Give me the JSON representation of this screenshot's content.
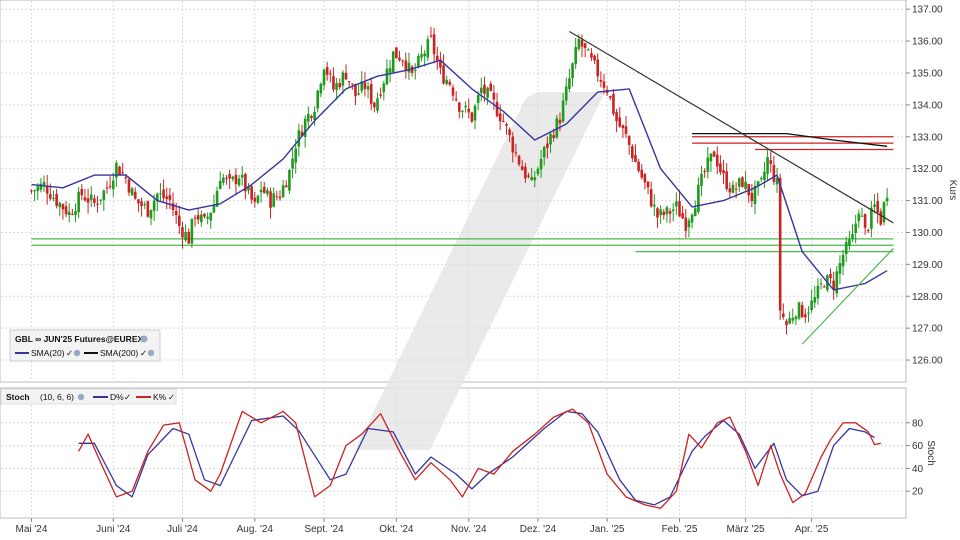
{
  "chart_data": [
    {
      "type": "candlestick",
      "instrument": "GBL ∞ JUN'25 Futures@EUREX",
      "ylabel": "Kurs",
      "ylim": [
        125.5,
        137.1
      ],
      "yticks": [
        126.0,
        127.0,
        128.0,
        129.0,
        130.0,
        131.0,
        132.0,
        133.0,
        134.0,
        135.0,
        136.0,
        137.0
      ],
      "ytick_labels": [
        "126.00",
        "127.00",
        "128.00",
        "129.00",
        "130.00",
        "131.00",
        "132.00",
        "133.00",
        "134.00",
        "135.00",
        "136.00",
        "137.00"
      ],
      "legend": [
        {
          "label": "SMA(20)",
          "color": "#3535a0"
        },
        {
          "label": "SMA(200)",
          "color": "#111111"
        }
      ],
      "colors": {
        "up": "#1e9b1e",
        "down": "#cc2222",
        "sma20": "#3535a0",
        "sma200": "#111111",
        "support": "#49b949",
        "resistance": "#cc2222",
        "trendline": "#333333"
      },
      "close_path": [
        [
          0,
          131.3
        ],
        [
          4,
          131.5
        ],
        [
          8,
          131.0
        ],
        [
          12,
          130.6
        ],
        [
          16,
          131.2
        ],
        [
          20,
          130.9
        ],
        [
          24,
          131.4
        ],
        [
          27,
          132.1
        ],
        [
          30,
          131.7
        ],
        [
          33,
          131.0
        ],
        [
          37,
          130.7
        ],
        [
          40,
          131.2
        ],
        [
          44,
          131.0
        ],
        [
          47,
          130.2
        ],
        [
          50,
          129.8
        ],
        [
          52,
          130.6
        ],
        [
          55,
          130.3
        ],
        [
          58,
          130.9
        ],
        [
          60,
          131.8
        ],
        [
          63,
          131.5
        ],
        [
          66,
          131.8
        ],
        [
          69,
          131.2
        ],
        [
          71,
          130.8
        ],
        [
          73,
          131.4
        ],
        [
          76,
          131.0
        ],
        [
          79,
          131.2
        ],
        [
          82,
          131.9
        ],
        [
          84,
          132.8
        ],
        [
          87,
          133.5
        ],
        [
          90,
          134.0
        ],
        [
          93,
          135.3
        ],
        [
          96,
          134.5
        ],
        [
          100,
          135.0
        ],
        [
          103,
          134.3
        ],
        [
          106,
          134.6
        ],
        [
          109,
          134.0
        ],
        [
          112,
          134.8
        ],
        [
          115,
          135.6
        ],
        [
          118,
          135.5
        ],
        [
          121,
          134.9
        ],
        [
          124,
          135.5
        ],
        [
          127,
          136.0
        ],
        [
          130,
          135.0
        ],
        [
          133,
          134.7
        ],
        [
          136,
          134.0
        ],
        [
          140,
          133.6
        ],
        [
          143,
          134.5
        ],
        [
          146,
          134.2
        ],
        [
          150,
          133.5
        ],
        [
          153,
          132.7
        ],
        [
          156,
          132.0
        ],
        [
          159,
          131.5
        ],
        [
          162,
          132.3
        ],
        [
          165,
          133.0
        ],
        [
          168,
          133.6
        ],
        [
          171,
          134.8
        ],
        [
          174,
          136.0
        ],
        [
          177,
          135.5
        ],
        [
          180,
          135.0
        ],
        [
          183,
          134.5
        ],
        [
          186,
          133.5
        ],
        [
          189,
          133.0
        ],
        [
          192,
          132.2
        ],
        [
          195,
          131.5
        ],
        [
          199,
          130.5
        ],
        [
          202,
          130.6
        ],
        [
          205,
          130.8
        ],
        [
          208,
          130.3
        ],
        [
          211,
          131.0
        ],
        [
          214,
          131.9
        ],
        [
          217,
          132.5
        ],
        [
          220,
          131.7
        ],
        [
          223,
          131.3
        ],
        [
          226,
          131.6
        ],
        [
          229,
          131.1
        ],
        [
          232,
          131.5
        ],
        [
          234,
          132.3
        ],
        [
          237,
          131.5
        ],
        [
          238,
          127.6
        ],
        [
          240,
          127.1
        ],
        [
          243,
          127.6
        ],
        [
          246,
          127.5
        ],
        [
          249,
          127.9
        ],
        [
          252,
          128.5
        ],
        [
          255,
          128.4
        ],
        [
          258,
          129.3
        ],
        [
          261,
          129.8
        ],
        [
          263,
          130.8
        ],
        [
          265,
          130.0
        ],
        [
          268,
          130.8
        ],
        [
          270,
          130.4
        ],
        [
          272,
          131.3
        ]
      ],
      "sma20_path": [
        [
          0,
          131.5
        ],
        [
          10,
          131.4
        ],
        [
          20,
          131.8
        ],
        [
          30,
          131.8
        ],
        [
          40,
          131.0
        ],
        [
          50,
          130.7
        ],
        [
          60,
          130.9
        ],
        [
          70,
          131.5
        ],
        [
          80,
          132.3
        ],
        [
          90,
          133.5
        ],
        [
          100,
          134.5
        ],
        [
          110,
          134.9
        ],
        [
          120,
          135.1
        ],
        [
          130,
          135.4
        ],
        [
          140,
          134.5
        ],
        [
          150,
          133.8
        ],
        [
          160,
          132.9
        ],
        [
          170,
          133.4
        ],
        [
          180,
          134.4
        ],
        [
          190,
          134.5
        ],
        [
          200,
          132.0
        ],
        [
          210,
          130.8
        ],
        [
          220,
          131.0
        ],
        [
          230,
          131.4
        ],
        [
          237,
          131.8
        ],
        [
          245,
          129.4
        ],
        [
          255,
          128.2
        ],
        [
          265,
          128.4
        ],
        [
          272,
          128.8
        ]
      ],
      "sma200_path": [
        [
          210,
          133.1
        ],
        [
          225,
          133.1
        ],
        [
          240,
          133.1
        ],
        [
          255,
          132.9
        ],
        [
          272,
          132.7
        ]
      ],
      "horizontal_lines": [
        {
          "value": 129.8,
          "from": 0,
          "to": 274,
          "color": "#49b949"
        },
        {
          "value": 129.6,
          "from": 0,
          "to": 274,
          "color": "#49b949"
        },
        {
          "value": 129.4,
          "from": 192,
          "to": 274,
          "color": "#49b949"
        },
        {
          "value": 133.0,
          "from": 210,
          "to": 274,
          "color": "#cc2222"
        },
        {
          "value": 132.8,
          "from": 210,
          "to": 274,
          "color": "#cc2222"
        },
        {
          "value": 132.6,
          "from": 230,
          "to": 274,
          "color": "#cc2222"
        }
      ],
      "trendlines": [
        {
          "from": [
            171,
            136.3
          ],
          "to": [
            274,
            130.3
          ],
          "color": "#333333"
        },
        {
          "from": [
            245,
            126.5
          ],
          "to": [
            274,
            129.5
          ],
          "color": "#49b949"
        }
      ]
    },
    {
      "type": "line",
      "title": "Stoch",
      "params": "(10, 6, 6)",
      "ylabel": "Stoch",
      "ylim": [
        0,
        100
      ],
      "yticks": [
        20,
        40,
        60,
        80
      ],
      "ytick_labels": [
        "20",
        "40",
        "60",
        "80"
      ],
      "series": [
        {
          "name": "D%",
          "color": "#3535a0",
          "points": [
            [
              15,
              62
            ],
            [
              20,
              62
            ],
            [
              27,
              25
            ],
            [
              32,
              15
            ],
            [
              37,
              52
            ],
            [
              45,
              75
            ],
            [
              50,
              70
            ],
            [
              55,
              30
            ],
            [
              60,
              25
            ],
            [
              70,
              82
            ],
            [
              80,
              86
            ],
            [
              85,
              73
            ],
            [
              95,
              30
            ],
            [
              100,
              35
            ],
            [
              107,
              75
            ],
            [
              115,
              72
            ],
            [
              122,
              35
            ],
            [
              127,
              50
            ],
            [
              135,
              35
            ],
            [
              140,
              22
            ],
            [
              145,
              35
            ],
            [
              153,
              50
            ],
            [
              163,
              75
            ],
            [
              170,
              90
            ],
            [
              175,
              88
            ],
            [
              180,
              72
            ],
            [
              187,
              30
            ],
            [
              192,
              12
            ],
            [
              198,
              8
            ],
            [
              203,
              15
            ],
            [
              210,
              55
            ],
            [
              214,
              68
            ],
            [
              220,
              82
            ],
            [
              225,
              70
            ],
            [
              230,
              40
            ],
            [
              236,
              62
            ],
            [
              240,
              30
            ],
            [
              245,
              16
            ],
            [
              250,
              20
            ],
            [
              255,
              60
            ],
            [
              260,
              75
            ],
            [
              265,
              72
            ],
            [
              268,
              67
            ]
          ]
        },
        {
          "name": "K%",
          "color": "#cc2222",
          "points": [
            [
              15,
              55
            ],
            [
              18,
              70
            ],
            [
              22,
              45
            ],
            [
              27,
              15
            ],
            [
              32,
              20
            ],
            [
              37,
              55
            ],
            [
              42,
              78
            ],
            [
              47,
              80
            ],
            [
              52,
              30
            ],
            [
              57,
              20
            ],
            [
              60,
              35
            ],
            [
              67,
              90
            ],
            [
              73,
              80
            ],
            [
              80,
              90
            ],
            [
              84,
              80
            ],
            [
              90,
              15
            ],
            [
              95,
              25
            ],
            [
              100,
              60
            ],
            [
              105,
              70
            ],
            [
              111,
              88
            ],
            [
              117,
              55
            ],
            [
              122,
              30
            ],
            [
              127,
              45
            ],
            [
              133,
              30
            ],
            [
              137,
              15
            ],
            [
              142,
              40
            ],
            [
              147,
              35
            ],
            [
              153,
              55
            ],
            [
              160,
              70
            ],
            [
              166,
              85
            ],
            [
              172,
              92
            ],
            [
              177,
              80
            ],
            [
              183,
              35
            ],
            [
              189,
              15
            ],
            [
              195,
              8
            ],
            [
              200,
              5
            ],
            [
              205,
              20
            ],
            [
              209,
              70
            ],
            [
              213,
              58
            ],
            [
              218,
              80
            ],
            [
              222,
              85
            ],
            [
              227,
              55
            ],
            [
              231,
              25
            ],
            [
              235,
              60
            ],
            [
              238,
              35
            ],
            [
              242,
              10
            ],
            [
              246,
              18
            ],
            [
              251,
              50
            ],
            [
              254,
              65
            ],
            [
              258,
              80
            ],
            [
              262,
              80
            ],
            [
              266,
              72
            ],
            [
              268,
              61
            ],
            [
              270,
              62
            ]
          ]
        }
      ]
    }
  ],
  "x_axis": {
    "tick_labels": [
      "Mai '24",
      "Juni '24",
      "Juli '24",
      "Aug. '24",
      "Sept. '24",
      "Okt. '24",
      "Nov. '24",
      "Dez. '24",
      "Jan. '25",
      "Feb. '25",
      "März '25",
      "Apr. '25"
    ],
    "tick_days": [
      0,
      26,
      48,
      71,
      93,
      116,
      139,
      161,
      183,
      206,
      227,
      248
    ],
    "day_range": [
      -10,
      278
    ]
  },
  "legend_main_title": "GBL ∞ JUN'25 Futures@EUREX",
  "legend_sma20": "SMA(20)",
  "legend_sma200": "SMA(200)",
  "stoch_title": "Stoch",
  "stoch_params": "(10, 6, 6)",
  "stoch_d_label": "D%",
  "stoch_k_label": "K%",
  "main_axis_label": "Kurs",
  "stoch_axis_label": "Stoch"
}
